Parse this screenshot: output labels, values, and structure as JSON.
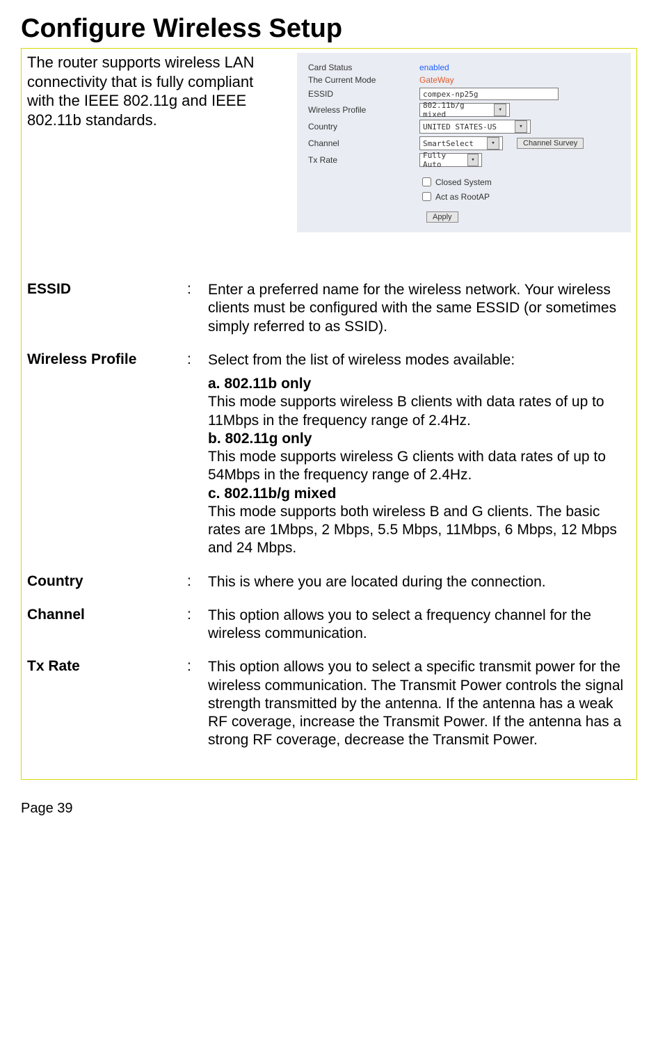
{
  "title": "Configure Wireless Setup",
  "intro": "The router supports wireless LAN connectivity that is fully compliant with the IEEE 802.11g and IEEE 802.11b standards.",
  "screenshot": {
    "labels": {
      "card_status": "Card Status",
      "current_mode": "The Current Mode",
      "essid": "ESSID",
      "wireless_profile": "Wireless Profile",
      "country": "Country",
      "channel": "Channel",
      "tx_rate": "Tx Rate"
    },
    "values": {
      "card_status": "enabled",
      "current_mode": "GateWay",
      "essid": "compex-np25g",
      "wireless_profile": "802.11b/g mixed",
      "country": "UNITED STATES-US",
      "channel": "SmartSelect",
      "tx_rate": "Fully Auto"
    },
    "channel_survey": "Channel Survey",
    "closed_system": "Closed System",
    "act_as_rootap": "Act as RootAP",
    "apply": "Apply"
  },
  "defs": {
    "essid": {
      "term": "ESSID",
      "body": "Enter a preferred name for the wireless network. Your wireless clients must be configured with the same ESSID (or sometimes simply referred to as SSID)."
    },
    "profile": {
      "term": "Wireless Profile",
      "intro": "Select from the list of wireless modes available:",
      "a_title": "a.  802.11b only",
      "a_body": "This mode supports wireless B clients with data rates of up to 11Mbps in the frequency range of 2.4Hz.",
      "b_title": "b.  802.11g only",
      "b_body": "This mode supports wireless G clients with data rates of up to 54Mbps in the frequency range of 2.4Hz.",
      "c_title": "c.  802.11b/g mixed",
      "c_body": "This mode supports both wireless B and G clients. The basic rates are 1Mbps, 2 Mbps, 5.5 Mbps, 11Mbps, 6 Mbps, 12 Mbps and 24 Mbps."
    },
    "country": {
      "term": "Country",
      "body": "This is where you are located during the connection."
    },
    "channel": {
      "term": "Channel",
      "body": "This option allows you to select a frequency channel for the wireless communication."
    },
    "tx_rate": {
      "term": "Tx Rate",
      "body": "This option allows you to select a specific transmit power for the wireless communication.   The Transmit Power controls the signal strength transmitted by the antenna. If the antenna has a weak RF coverage, increase the Transmit Power. If the antenna has a strong RF coverage, decrease the Transmit Power."
    }
  },
  "page_number": "Page 39"
}
